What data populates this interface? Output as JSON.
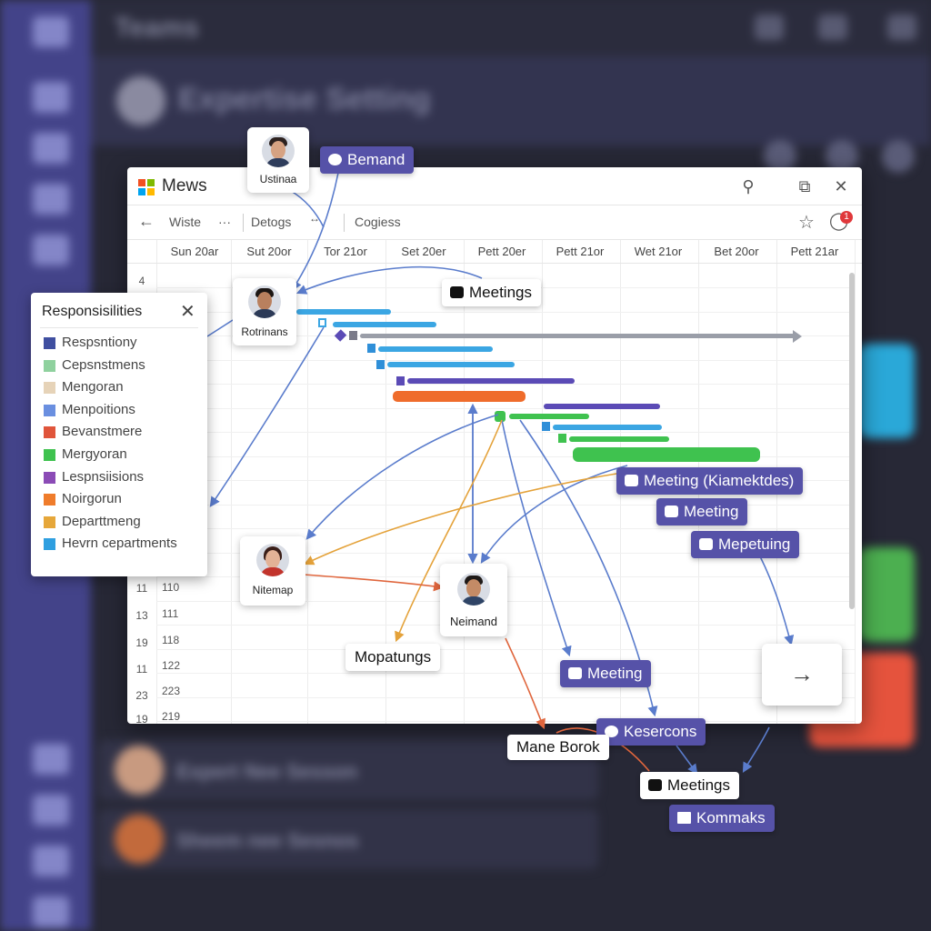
{
  "background_app": {
    "title": "Teams",
    "header_title": "Expertise Setting",
    "list_rows": [
      "Expert Nee Sesson",
      "Sheem nee Sesnos"
    ]
  },
  "window": {
    "title": "Mews",
    "toolbar": {
      "item1": "Wiste",
      "more": "···",
      "item2": "Detogs",
      "item3": "Cogiess"
    },
    "notification_count": "1",
    "dates": [
      "Sun 20ar",
      "Sut 20or",
      "Tor 21or",
      "Set 20er",
      "Pett 20er",
      "Pett 21or",
      "Wet 21or",
      "Bet 20or",
      "Pett 21ar"
    ],
    "row_numbers": [
      "4",
      "11",
      "13",
      "19",
      "11",
      "23",
      "19"
    ],
    "col_values": [
      "110",
      "111",
      "118",
      "122",
      "223",
      "219"
    ]
  },
  "gantt_colors": {
    "blue": "#3ba6e3",
    "purple": "#5b4bb6",
    "orange": "#ef6c2b",
    "green": "#3fc24f",
    "gray": "#9a9ea8"
  },
  "people": [
    {
      "name": "Ustinaa"
    },
    {
      "name": "Rotrinans"
    },
    {
      "name": "Nitemap"
    },
    {
      "name": "Neimand"
    }
  ],
  "chips": {
    "bemand": "Bemand",
    "meetings_top": "Meetings",
    "meeting_k": "Meeting (Kiamektdes)",
    "meeting2": "Meeting",
    "mepetuing": "Mepetuing",
    "mopatungs": "Mopatungs",
    "meeting3": "Meeting",
    "kesercons": "Kesercons",
    "mane_borok": "Mane Borok",
    "meetings_bottom": "Meetings",
    "kommaks": "Kommaks"
  },
  "responsibilities": {
    "title": "Responsisilities",
    "items": [
      {
        "label": "Respsntiony",
        "color": "#3f4fa0"
      },
      {
        "label": "Cepsnstmens",
        "color": "#8fd19e"
      },
      {
        "label": "Mengoran",
        "color": "#e6d3b8"
      },
      {
        "label": "Menpoitions",
        "color": "#6a8fe0"
      },
      {
        "label": "Bevanstmere",
        "color": "#e0553b"
      },
      {
        "label": "Mergyoran",
        "color": "#3fc24f"
      },
      {
        "label": "Lespnsiisions",
        "color": "#8b4bb6"
      },
      {
        "label": "Noirgorun",
        "color": "#ef7c2b"
      },
      {
        "label": "Departtmeng",
        "color": "#e6a73a"
      },
      {
        "label": "Hevrn cepartments",
        "color": "#2f9fe0"
      }
    ]
  }
}
